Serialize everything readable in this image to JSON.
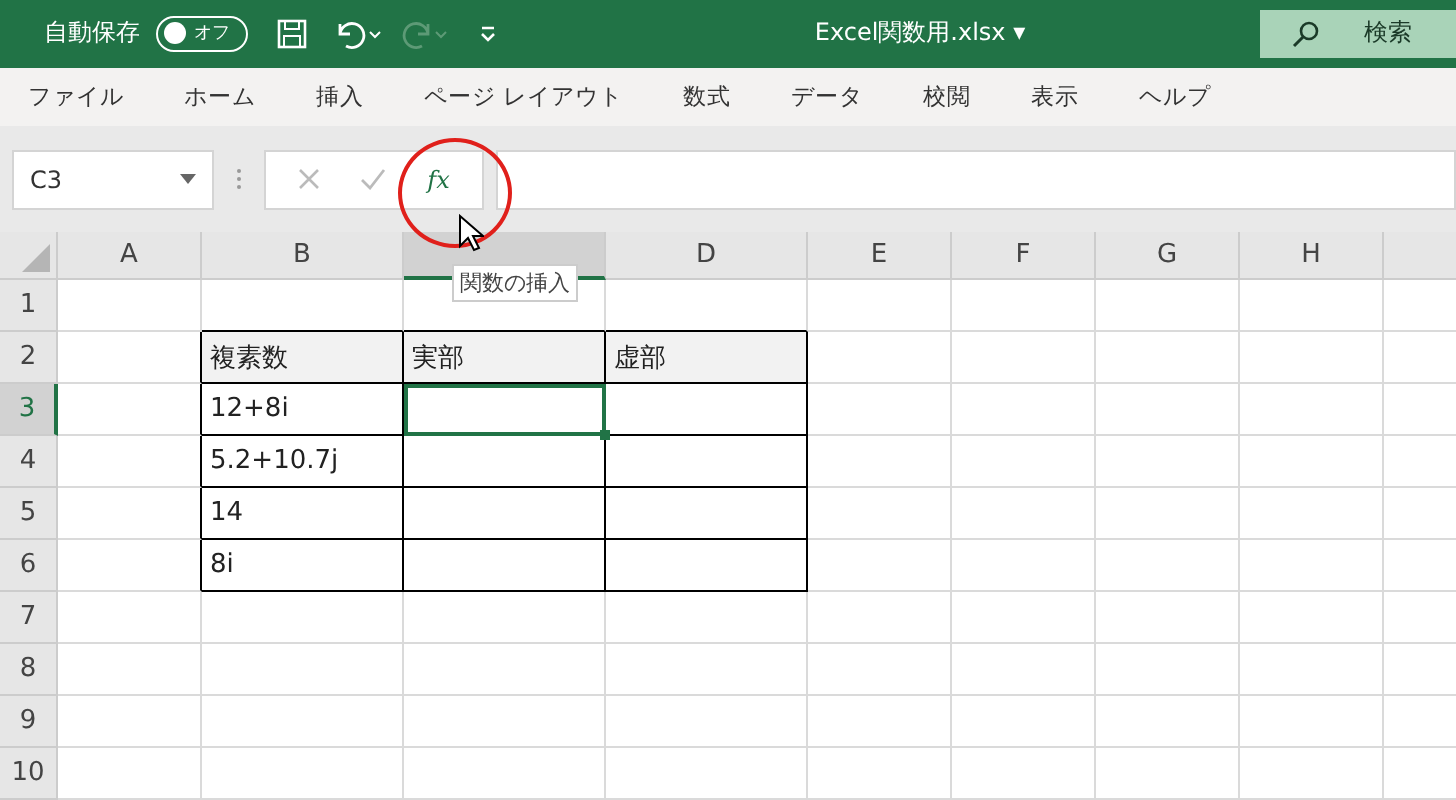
{
  "title_bar": {
    "autosave_label": "自動保存",
    "autosave_toggle": {
      "label": "オフ",
      "on": false
    },
    "file_name": "Excel関数用.xlsx",
    "file_caret": "▾",
    "search": {
      "placeholder": "検索"
    }
  },
  "menu": [
    {
      "label": "ファイル"
    },
    {
      "label": "ホーム"
    },
    {
      "label": "挿入"
    },
    {
      "label": "ページ レイアウト"
    },
    {
      "label": "数式"
    },
    {
      "label": "データ"
    },
    {
      "label": "校閲"
    },
    {
      "label": "表示"
    },
    {
      "label": "ヘルプ"
    }
  ],
  "formula_bar": {
    "name_box": "C3",
    "function_button": "fx",
    "tooltip": "関数の挿入"
  },
  "columns": [
    {
      "label": "A",
      "selected": false
    },
    {
      "label": "B",
      "selected": false
    },
    {
      "selected": true
    },
    {
      "label": "D",
      "selected": false
    },
    {
      "label": "E",
      "selected": false
    },
    {
      "label": "F",
      "selected": false
    },
    {
      "label": "G",
      "selected": false
    },
    {
      "label": "H",
      "selected": false
    }
  ],
  "rows": [
    {
      "label": "1",
      "selected": false
    },
    {
      "label": "2",
      "selected": false
    },
    {
      "label": "3",
      "selected": true
    },
    {
      "label": "4",
      "selected": false
    },
    {
      "label": "5",
      "selected": false
    },
    {
      "label": "6",
      "selected": false
    },
    {
      "label": "7",
      "selected": false
    },
    {
      "label": "8",
      "selected": false
    },
    {
      "label": "9",
      "selected": false
    },
    {
      "label": "10",
      "selected": false
    }
  ],
  "table": {
    "header": [
      "複素数",
      "実部",
      "虚部"
    ],
    "rows": [
      {
        "value": "12+8i",
        "active": true
      },
      {
        "value": "5.2+10.7j",
        "active": false
      },
      {
        "value": "14",
        "active": false
      },
      {
        "value": "8i",
        "active": false
      }
    ]
  }
}
